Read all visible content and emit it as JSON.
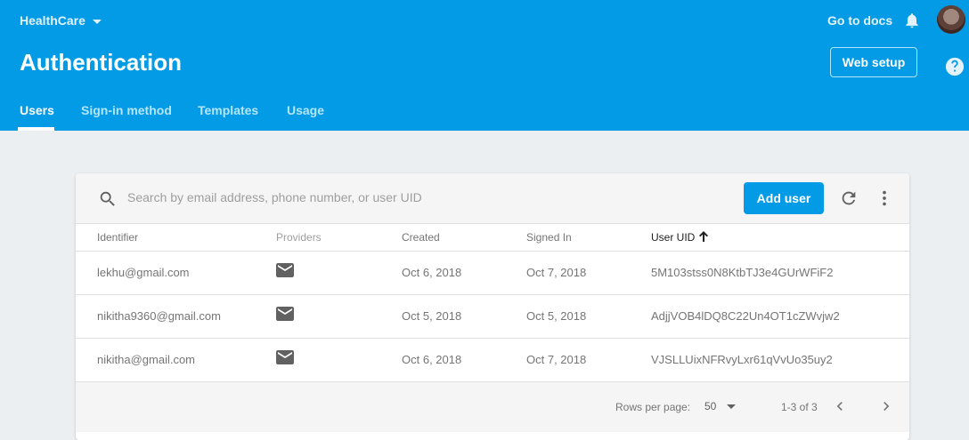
{
  "header": {
    "project": "HealthCare",
    "docs_link": "Go to docs",
    "title": "Authentication",
    "web_setup_label": "Web setup",
    "bg_color": "#039be5"
  },
  "tabs": [
    {
      "label": "Users",
      "active": true
    },
    {
      "label": "Sign-in method",
      "active": false
    },
    {
      "label": "Templates",
      "active": false
    },
    {
      "label": "Usage",
      "active": false
    }
  ],
  "toolbar": {
    "search_placeholder": "Search by email address, phone number, or user UID",
    "search_value": "",
    "add_user_label": "Add user"
  },
  "table": {
    "columns": [
      "Identifier",
      "Providers",
      "Created",
      "Signed In",
      "User UID"
    ],
    "sorted_column": "User UID",
    "sort_direction": "ascending",
    "rows": [
      {
        "identifier": "lekhu@gmail.com",
        "provider_icon": "mail-icon",
        "created": "Oct 6, 2018",
        "signed_in": "Oct 7, 2018",
        "uid": "5M103stss0N8KtbTJ3e4GUrWFiF2"
      },
      {
        "identifier": "nikitha9360@gmail.com",
        "provider_icon": "mail-icon",
        "created": "Oct 5, 2018",
        "signed_in": "Oct 5, 2018",
        "uid": "AdjjVOB4lDQ8C22Un4OT1cZWvjw2"
      },
      {
        "identifier": "nikitha@gmail.com",
        "provider_icon": "mail-icon",
        "created": "Oct 6, 2018",
        "signed_in": "Oct 7, 2018",
        "uid": "VJSLLUixNFRvyLxr61qVvUo35uy2"
      }
    ]
  },
  "pagination": {
    "rows_per_page_label": "Rows per page:",
    "rows_per_page": "50",
    "range": "1-3 of 3"
  }
}
